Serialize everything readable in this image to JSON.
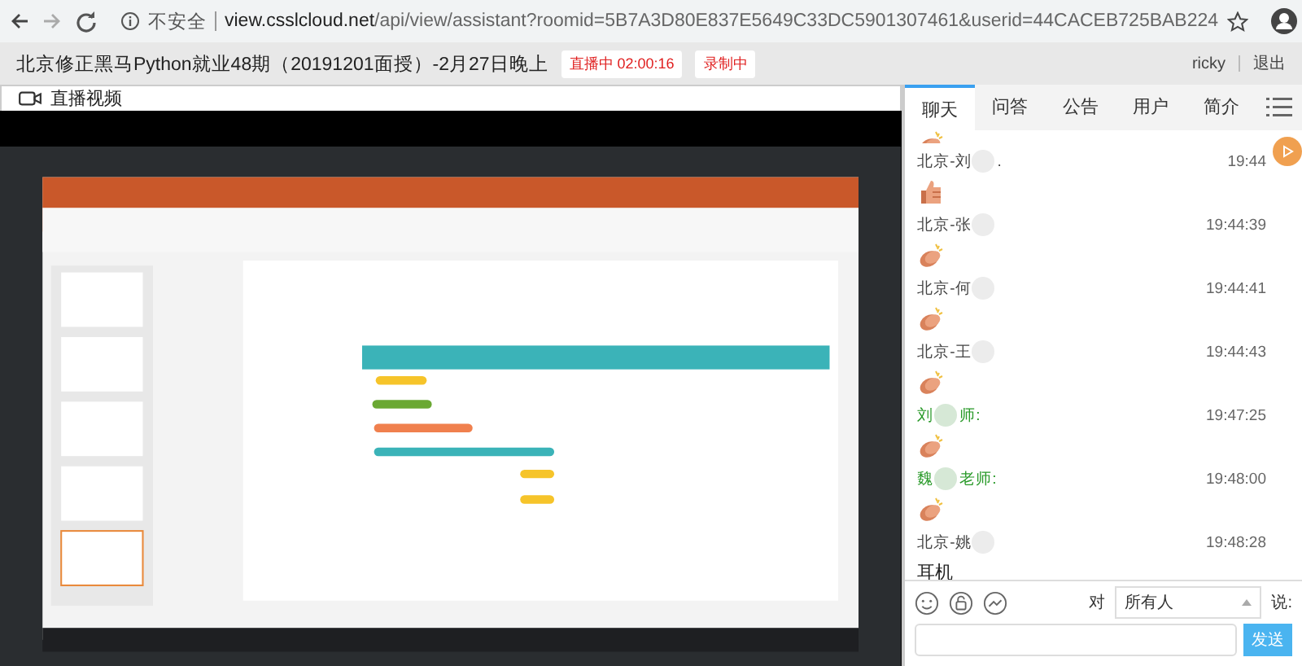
{
  "browser": {
    "security": "不安全",
    "url_host": "view.csslcloud.net",
    "url_path": "/api/view/assistant?roomid=5B7A3D80E837E5649C33DC5901307461&userid=44CACEB725BAB224"
  },
  "header": {
    "title": "北京修正黑马Python就业48期（20191201面授）-2月27日晚上",
    "live_badge": "直播中 02:00:16",
    "record_badge": "录制中",
    "user": "ricky",
    "logout": "退出"
  },
  "video": {
    "title": "直播视频"
  },
  "chat": {
    "tabs": [
      {
        "label": "聊天",
        "selected": true
      },
      {
        "label": "问答",
        "selected": false
      },
      {
        "label": "公告",
        "selected": false
      },
      {
        "label": "用户",
        "selected": false
      },
      {
        "label": "简介",
        "selected": false
      }
    ],
    "messages": [
      {
        "kind": "thumbs",
        "name": "北京-刘",
        "name_tail": ".",
        "teacher": false,
        "time": "19:44"
      },
      {
        "kind": "clap",
        "name": "北京-张",
        "teacher": false,
        "time": "19:44:39"
      },
      {
        "kind": "clap",
        "name": "北京-何",
        "teacher": false,
        "time": "19:44:41"
      },
      {
        "kind": "clap",
        "name": "北京-王",
        "teacher": false,
        "time": "19:44:43"
      },
      {
        "kind": "clap",
        "name": "刘",
        "name_tail": "师:",
        "teacher": true,
        "time": "19:47:25"
      },
      {
        "kind": "clap",
        "name": "魏",
        "name_tail": "老师:",
        "teacher": true,
        "time": "19:48:00"
      },
      {
        "kind": "text",
        "text": "耳机",
        "name": "北京-姚",
        "teacher": false,
        "time": "19:48:28"
      }
    ],
    "to_label": "对",
    "recipient": "所有人",
    "say_label": "说:",
    "send": "发送"
  }
}
